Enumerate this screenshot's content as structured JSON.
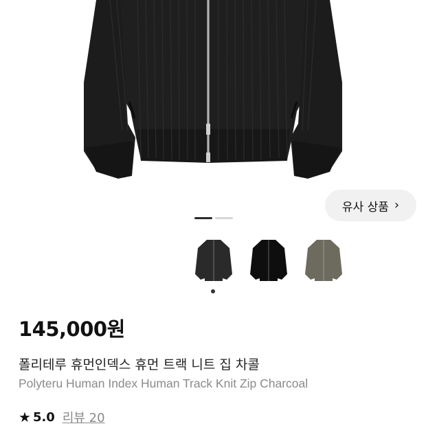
{
  "similar_products": {
    "label": "유사 상품",
    "chevron": "›"
  },
  "gallery": {
    "total_slides": 2,
    "current_slide": 1
  },
  "color_options": [
    {
      "color": "#2a2a2a"
    },
    {
      "color": "#0e0e0e"
    },
    {
      "color": "#6d6b5e"
    }
  ],
  "selected_color_index": 1,
  "price": "145,000원",
  "product": {
    "title_ko": "폴리테루 휴먼인덱스 휴먼 트랙 니트 집 차콜",
    "title_en": "Polyteru Human Index Human Track Knit Zip Charcoal"
  },
  "rating": {
    "score": "5.0",
    "reviews_label": "리뷰 20"
  }
}
